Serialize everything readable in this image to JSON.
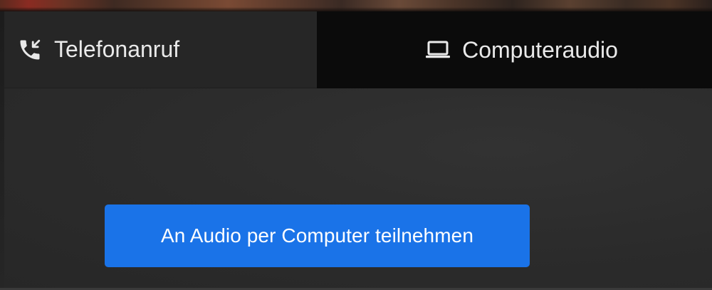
{
  "tabs": {
    "phone": {
      "label": "Telefonanruf",
      "icon": "phone-incoming-icon"
    },
    "computer": {
      "label": "Computeraudio",
      "icon": "laptop-icon",
      "active": true
    }
  },
  "main": {
    "join_button_label": "An Audio per Computer teilnehmen"
  },
  "colors": {
    "accent": "#1a73e8",
    "active_tab_bg": "#0b0b0b",
    "inactive_tab_bg": "#262626",
    "panel_bg": "#2b2b2b",
    "text": "#e9e9e9"
  }
}
